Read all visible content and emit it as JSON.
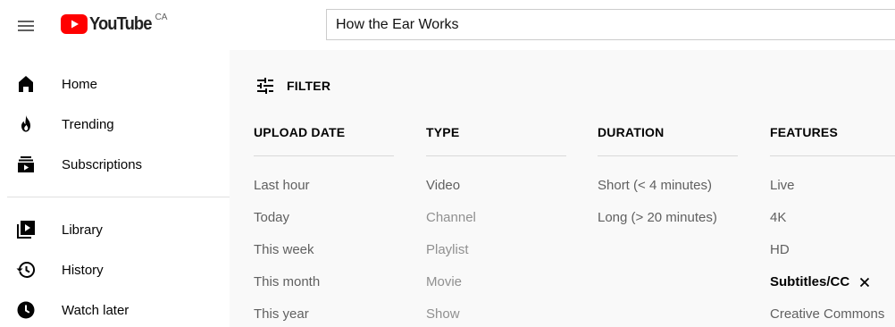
{
  "header": {
    "logo_text": "YouTube",
    "country_code": "CA",
    "search_query": "How the Ear Works",
    "brand_color": "#ff0000"
  },
  "sidebar": {
    "primary": [
      {
        "label": "Home",
        "icon": "home-icon"
      },
      {
        "label": "Trending",
        "icon": "trending-icon"
      },
      {
        "label": "Subscriptions",
        "icon": "subscriptions-icon"
      }
    ],
    "secondary": [
      {
        "label": "Library",
        "icon": "library-icon"
      },
      {
        "label": "History",
        "icon": "history-icon"
      },
      {
        "label": "Watch later",
        "icon": "clock-icon"
      }
    ]
  },
  "filter": {
    "toggle_label": "FILTER",
    "groups": [
      {
        "header": "UPLOAD DATE",
        "options": [
          {
            "label": "Last hour",
            "state": "enabled"
          },
          {
            "label": "Today",
            "state": "enabled"
          },
          {
            "label": "This week",
            "state": "enabled"
          },
          {
            "label": "This month",
            "state": "enabled"
          },
          {
            "label": "This year",
            "state": "enabled"
          }
        ]
      },
      {
        "header": "TYPE",
        "options": [
          {
            "label": "Video",
            "state": "enabled"
          },
          {
            "label": "Channel",
            "state": "disabled"
          },
          {
            "label": "Playlist",
            "state": "disabled"
          },
          {
            "label": "Movie",
            "state": "disabled"
          },
          {
            "label": "Show",
            "state": "disabled"
          }
        ]
      },
      {
        "header": "DURATION",
        "options": [
          {
            "label": "Short (< 4 minutes)",
            "state": "enabled"
          },
          {
            "label": "Long (> 20 minutes)",
            "state": "enabled"
          }
        ]
      },
      {
        "header": "FEATURES",
        "options": [
          {
            "label": "Live",
            "state": "enabled"
          },
          {
            "label": "4K",
            "state": "enabled"
          },
          {
            "label": "HD",
            "state": "enabled"
          },
          {
            "label": "Subtitles/CC",
            "state": "selected"
          },
          {
            "label": "Creative Commons",
            "state": "enabled"
          }
        ]
      }
    ]
  }
}
